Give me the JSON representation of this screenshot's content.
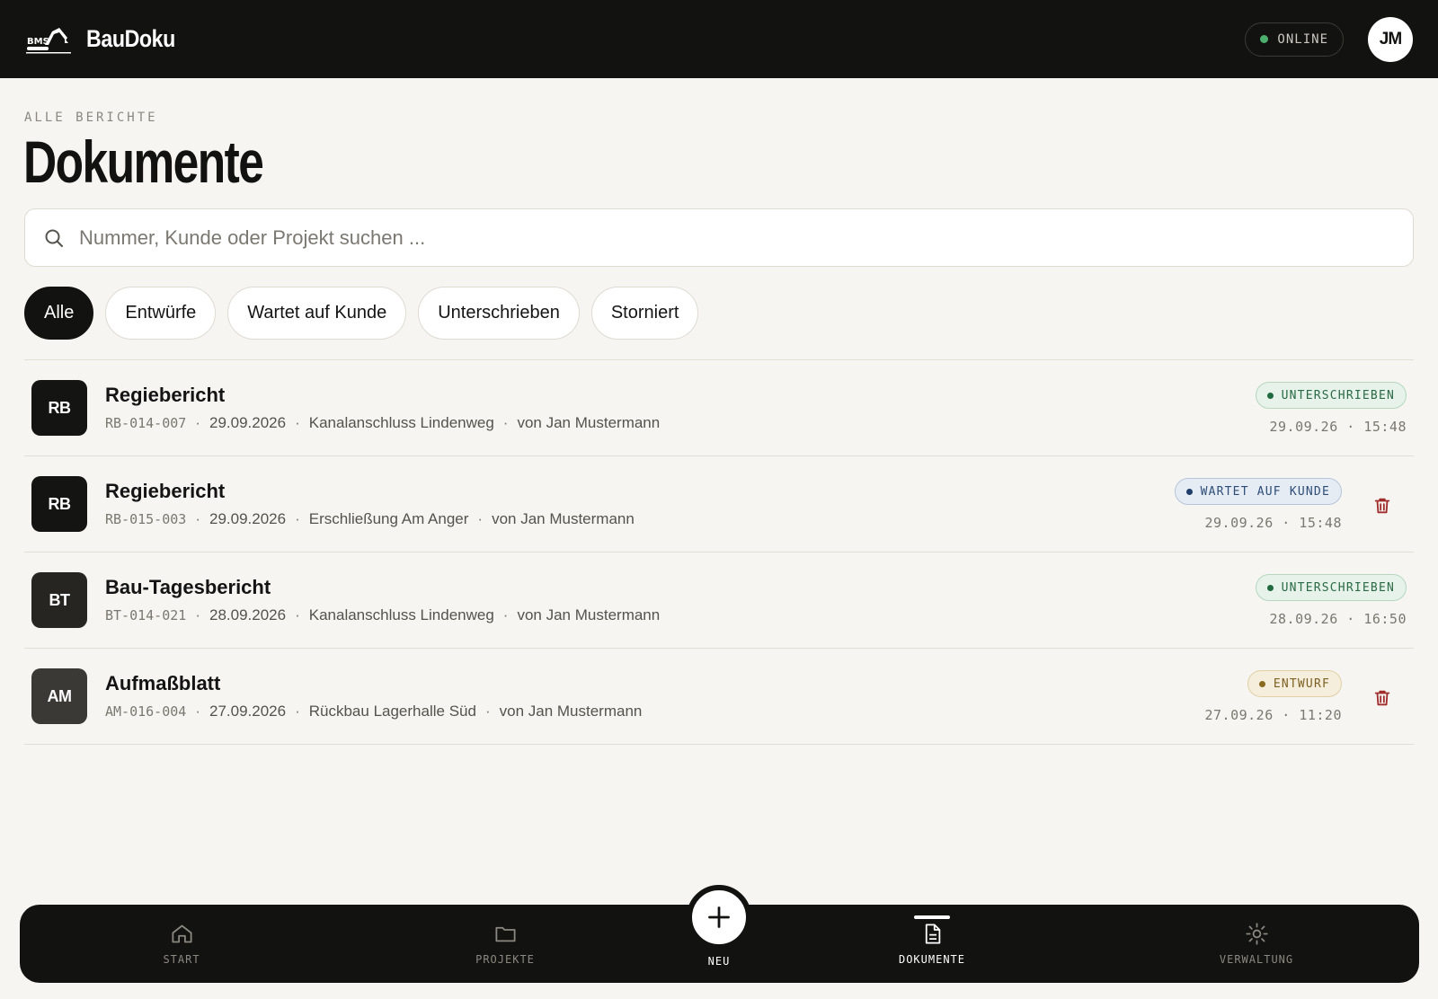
{
  "header": {
    "app_name": "BauDoku",
    "logo_text": "BMS",
    "status": "ONLINE",
    "avatar_initials": "JM"
  },
  "page": {
    "eyebrow": "ALLE BERICHTE",
    "title": "Dokumente"
  },
  "search": {
    "placeholder": "Nummer, Kunde oder Projekt suchen ..."
  },
  "filters": [
    "Alle",
    "Entwürfe",
    "Wartet auf Kunde",
    "Unterschrieben",
    "Storniert"
  ],
  "documents": [
    {
      "initials": "RB",
      "title": "Regiebericht",
      "number": "RB-014-007",
      "date": "29.09.2026",
      "project": "Kanalanschluss Lindenweg",
      "author": "von Jan Mustermann",
      "status": "UNTERSCHRIEBEN",
      "timestamp": "29.09.26 · 15:48"
    },
    {
      "initials": "RB",
      "title": "Regiebericht",
      "number": "RB-015-003",
      "date": "29.09.2026",
      "project": "Erschließung Am Anger",
      "author": "von Jan Mustermann",
      "status": "WARTET AUF KUNDE",
      "timestamp": "29.09.26 · 15:48"
    },
    {
      "initials": "BT",
      "title": "Bau-Tagesbericht",
      "number": "BT-014-021",
      "date": "28.09.2026",
      "project": "Kanalanschluss Lindenweg",
      "author": "von Jan Mustermann",
      "status": "UNTERSCHRIEBEN",
      "timestamp": "28.09.26 · 16:50"
    },
    {
      "initials": "AM",
      "title": "Aufmaßblatt",
      "number": "AM-016-004",
      "date": "27.09.2026",
      "project": "Rückbau Lagerhalle Süd",
      "author": "von Jan Mustermann",
      "status": "ENTWURF",
      "timestamp": "27.09.26 · 11:20"
    }
  ],
  "nav": {
    "start": "START",
    "projekte": "PROJEKTE",
    "neu": "NEU",
    "dokumente": "DOKUMENTE",
    "verwaltung": "VERWALTUNG"
  },
  "colors": {
    "header_bg": "#121210",
    "page_bg": "#f6f5f1",
    "status_signed": "#1f6a3e",
    "status_waiting": "#1f3f6a",
    "status_draft": "#8a6a1f",
    "trash": "#a02c2c",
    "online_dot": "#4caf6e"
  },
  "icons": {
    "search": "search-icon",
    "trash": "trash-icon",
    "home": "home-icon",
    "folder": "folder-icon",
    "plus": "plus-icon",
    "document": "document-icon",
    "gear": "gear-icon"
  }
}
